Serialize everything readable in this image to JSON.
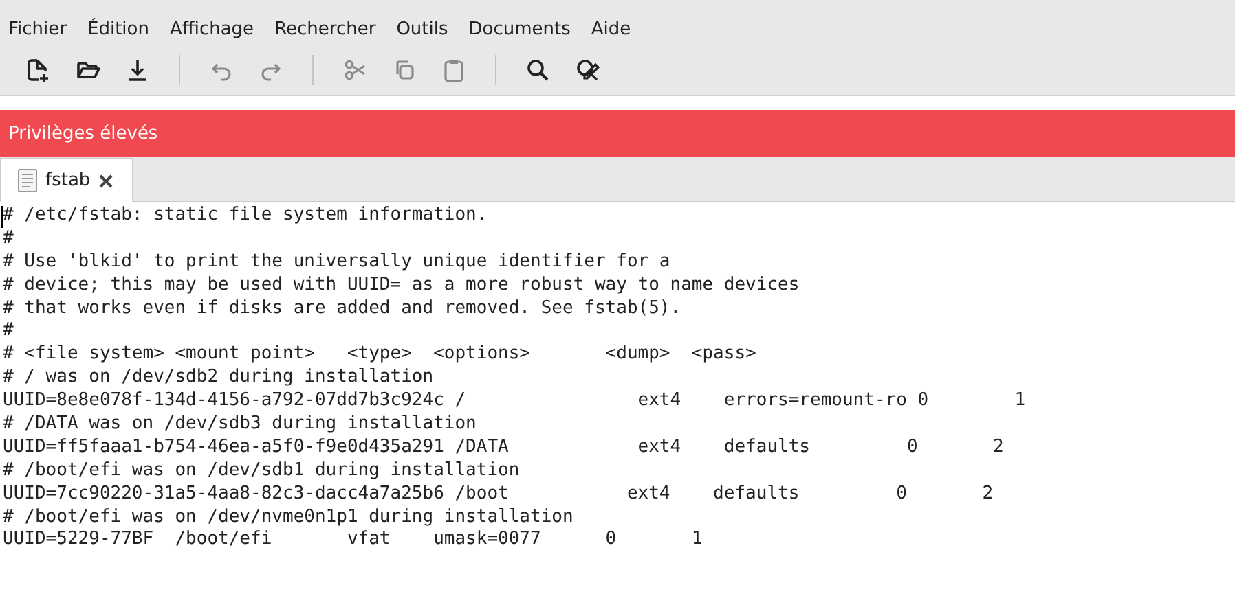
{
  "menu": [
    "Fichier",
    "Édition",
    "Affichage",
    "Rechercher",
    "Outils",
    "Documents",
    "Aide"
  ],
  "toolbar": [
    {
      "kind": "new",
      "disabled": false
    },
    {
      "kind": "open",
      "disabled": false
    },
    {
      "kind": "save",
      "disabled": false
    },
    {
      "kind": "separator"
    },
    {
      "kind": "undo",
      "disabled": true
    },
    {
      "kind": "redo",
      "disabled": true
    },
    {
      "kind": "separator"
    },
    {
      "kind": "cut",
      "disabled": true
    },
    {
      "kind": "copy",
      "disabled": true
    },
    {
      "kind": "paste",
      "disabled": true
    },
    {
      "kind": "separator"
    },
    {
      "kind": "search",
      "disabled": false
    },
    {
      "kind": "replace",
      "disabled": false
    }
  ],
  "banner": "Privilèges élevés",
  "tabs": [
    {
      "label": "fstab",
      "selected": true
    }
  ],
  "lines": [
    "# /etc/fstab: static file system information.",
    "#",
    "# Use 'blkid' to print the universally unique identifier for a",
    "# device; this may be used with UUID= as a more robust way to name devices",
    "# that works even if disks are added and removed. See fstab(5).",
    "#",
    "# <file system> <mount point>   <type>  <options>       <dump>  <pass>",
    "# / was on /dev/sdb2 during installation",
    "UUID=8e8e078f-134d-4156-a792-07dd7b3c924c /                ext4    errors=remount-ro 0        1",
    "# /DATA was on /dev/sdb3 during installation",
    "UUID=ff5faaa1-b754-46ea-a5f0-f9e0d435a291 /DATA            ext4    defaults         0       2",
    "# /boot/efi was on /dev/sdb1 during installation",
    "UUID=7cc90220-31a5-4aa8-82c3-dacc4a7a25b6 /boot           ext4    defaults         0       2",
    "# /boot/efi was on /dev/nvme0n1p1 during installation",
    "UUID=5229-77BF  /boot/efi       vfat    umask=0077      0       1"
  ]
}
